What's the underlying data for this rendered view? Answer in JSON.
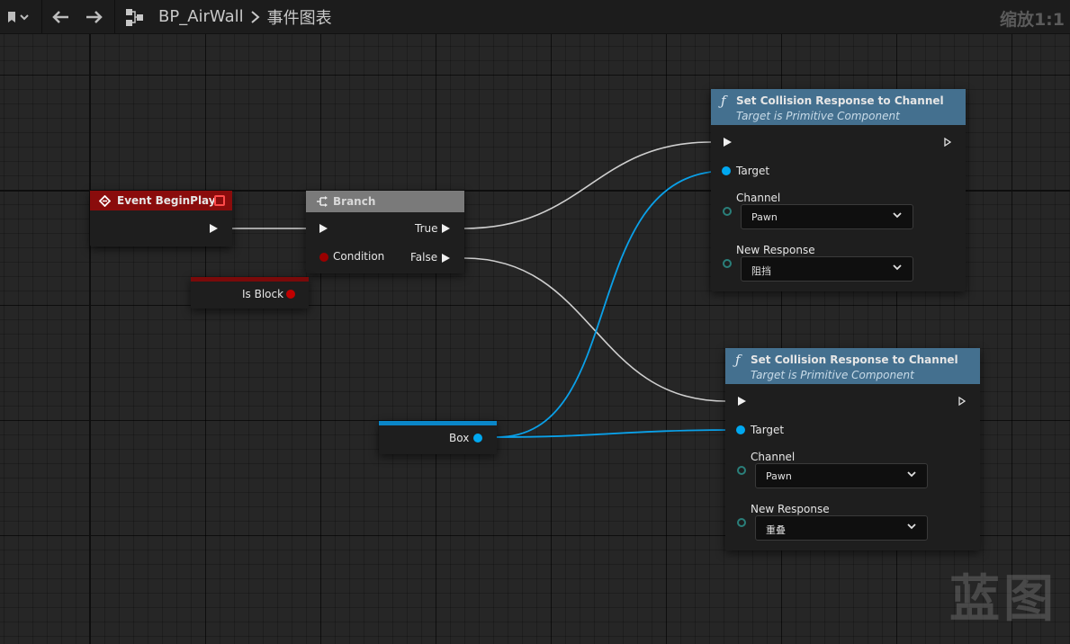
{
  "toolbar": {
    "bookmark_icon": "bookmark-icon",
    "back_icon": "arrow-left-icon",
    "forward_icon": "arrow-right-icon",
    "graph_icon": "blueprint-graph-icon",
    "blueprint_name": "BP_AirWall",
    "breadcrumb_separator": ">",
    "graph_name": "事件图表",
    "zoom_label": "缩放1:1"
  },
  "nodes": {
    "event_begin_play": {
      "title": "Event BeginPlay",
      "color": "#8a0c0c"
    },
    "branch": {
      "title": "Branch",
      "true_label": "True",
      "false_label": "False",
      "condition_label": "Condition",
      "color": "#7a7a7a"
    },
    "is_block": {
      "label": "Is Block",
      "pin_color": "#9a0000"
    },
    "box": {
      "label": "Box",
      "pin_color": "#00a8f0"
    },
    "set_collision_1": {
      "title": "Set Collision Response to Channel",
      "subtitle": "Target is Primitive Component",
      "target_label": "Target",
      "channel_label": "Channel",
      "channel_value": "Pawn",
      "response_label": "New Response",
      "response_value": "阻挡",
      "header_color": "#44708f"
    },
    "set_collision_2": {
      "title": "Set Collision Response to Channel",
      "subtitle": "Target is Primitive Component",
      "target_label": "Target",
      "channel_label": "Channel",
      "channel_value": "Pawn",
      "response_label": "New Response",
      "response_value": "重叠",
      "header_color": "#44708f"
    }
  },
  "watermark": "蓝图"
}
